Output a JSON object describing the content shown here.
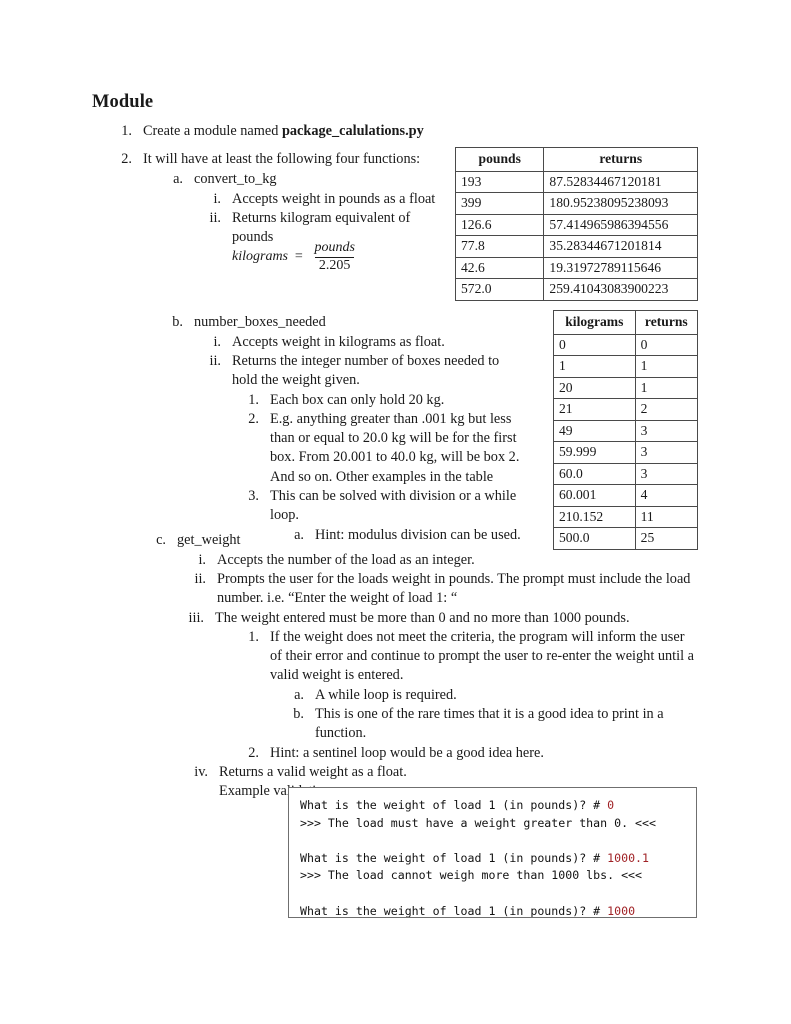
{
  "document": {
    "title": "Module"
  },
  "outline": [
    {
      "id": "item-1",
      "marker": "1.",
      "text_before": "Create a module named ",
      "bold": "package_calulations.py",
      "text_after": ""
    },
    {
      "id": "item-2",
      "marker": "2.",
      "text": "It will have at least the following four functions:"
    },
    {
      "id": "item-2a",
      "marker": "a.",
      "text": "convert_to_kg"
    },
    {
      "id": "item-2a-i",
      "marker": "i.",
      "text": "Accepts weight in pounds as a float"
    },
    {
      "id": "item-2a-ii",
      "marker": "ii.",
      "text": "Returns kilogram equivalent of pounds"
    },
    {
      "id": "item-2b",
      "marker": "b.",
      "text": "number_boxes_needed"
    },
    {
      "id": "item-2b-i",
      "marker": "i.",
      "text": "Accepts weight in kilograms as float."
    },
    {
      "id": "item-2b-ii",
      "marker": "ii.",
      "text": "Returns the integer number of boxes needed to hold the weight given."
    },
    {
      "id": "item-2b-ii-1",
      "marker": "1.",
      "text": "Each box can only hold 20 kg."
    },
    {
      "id": "item-2b-ii-2",
      "marker": "2.",
      "text": "E.g. anything greater than .001 kg but less than or equal to 20.0 kg will be for the first box. From 20.001 to 40.0 kg, will be box 2. And so on. Other examples in the table"
    },
    {
      "id": "item-2b-ii-3",
      "marker": "3.",
      "text": "This can be solved with division or a while loop."
    },
    {
      "id": "item-2b-ii-3-a",
      "marker": "a.",
      "text": "Hint: modulus division can be used."
    },
    {
      "id": "item-2c",
      "marker": "c.",
      "text": "get_weight"
    },
    {
      "id": "item-2c-i",
      "marker": "i.",
      "text": "Accepts the number of the load as an integer."
    },
    {
      "id": "item-2c-ii",
      "marker": "ii.",
      "text": "Prompts the user for the loads weight in pounds. The prompt must include the load number. i.e. “Enter the weight of load 1: “"
    },
    {
      "id": "item-2c-iii",
      "marker": "iii.",
      "text": "The weight entered must be more than 0 and  no more than 1000 pounds."
    },
    {
      "id": "item-2c-iii-1",
      "marker": "1.",
      "text": "If the weight does not meet the criteria, the program will inform the user of their error and continue to prompt the user to re-enter the weight until a valid weight is entered."
    },
    {
      "id": "item-2c-iii-1-a",
      "marker": "a.",
      "text": "A while loop is required."
    },
    {
      "id": "item-2c-iii-1-b",
      "marker": "b.",
      "text": "This is one of the rare times that it is a good idea to print in a function."
    },
    {
      "id": "item-2c-iii-2",
      "marker": "2.",
      "text": "Hint: a sentinel loop would be a good idea here."
    },
    {
      "id": "item-2c-iv",
      "marker": "iv.",
      "text": "Returns a valid weight as a float."
    },
    {
      "id": "item-example-validation",
      "marker": "",
      "text": "Example validation:"
    }
  ],
  "formula": {
    "lhs": "kilograms",
    "equals": "=",
    "numerator": "pounds",
    "denominator": "2.205"
  },
  "tables": {
    "pounds_table": {
      "headers": [
        "pounds",
        "returns"
      ],
      "rows": [
        [
          "193",
          "87.52834467120181"
        ],
        [
          "399",
          "180.95238095238093"
        ],
        [
          "126.6",
          "57.414965986394556"
        ],
        [
          "77.8",
          "35.28344671201814"
        ],
        [
          "42.6",
          "19.31972789115646"
        ],
        [
          "572.0",
          "259.41043083900223"
        ]
      ]
    },
    "kilograms_table": {
      "headers": [
        "kilograms",
        "returns"
      ],
      "rows": [
        [
          "0",
          "0"
        ],
        [
          "1",
          "1"
        ],
        [
          "20",
          "1"
        ],
        [
          "21",
          "2"
        ],
        [
          "49",
          "3"
        ],
        [
          "59.999",
          "3"
        ],
        [
          "60.0",
          "3"
        ],
        [
          "60.001",
          "4"
        ],
        [
          "210.152",
          "11"
        ],
        [
          "500.0",
          "25"
        ]
      ]
    }
  },
  "console": {
    "lines": [
      {
        "text": "What is the weight of load 1 (in pounds)? # ",
        "value": "0"
      },
      {
        "text": ">>> The load must have a weight greater than 0. <<<",
        "value": ""
      },
      {
        "text": "",
        "value": ""
      },
      {
        "text": "What is the weight of load 1 (in pounds)? # ",
        "value": "1000.1"
      },
      {
        "text": ">>> The load cannot weigh more than 1000 lbs. <<<",
        "value": ""
      },
      {
        "text": "",
        "value": ""
      },
      {
        "text": "What is the weight of load 1 (in pounds)? # ",
        "value": "1000"
      }
    ],
    "value_color": "#a02226"
  }
}
